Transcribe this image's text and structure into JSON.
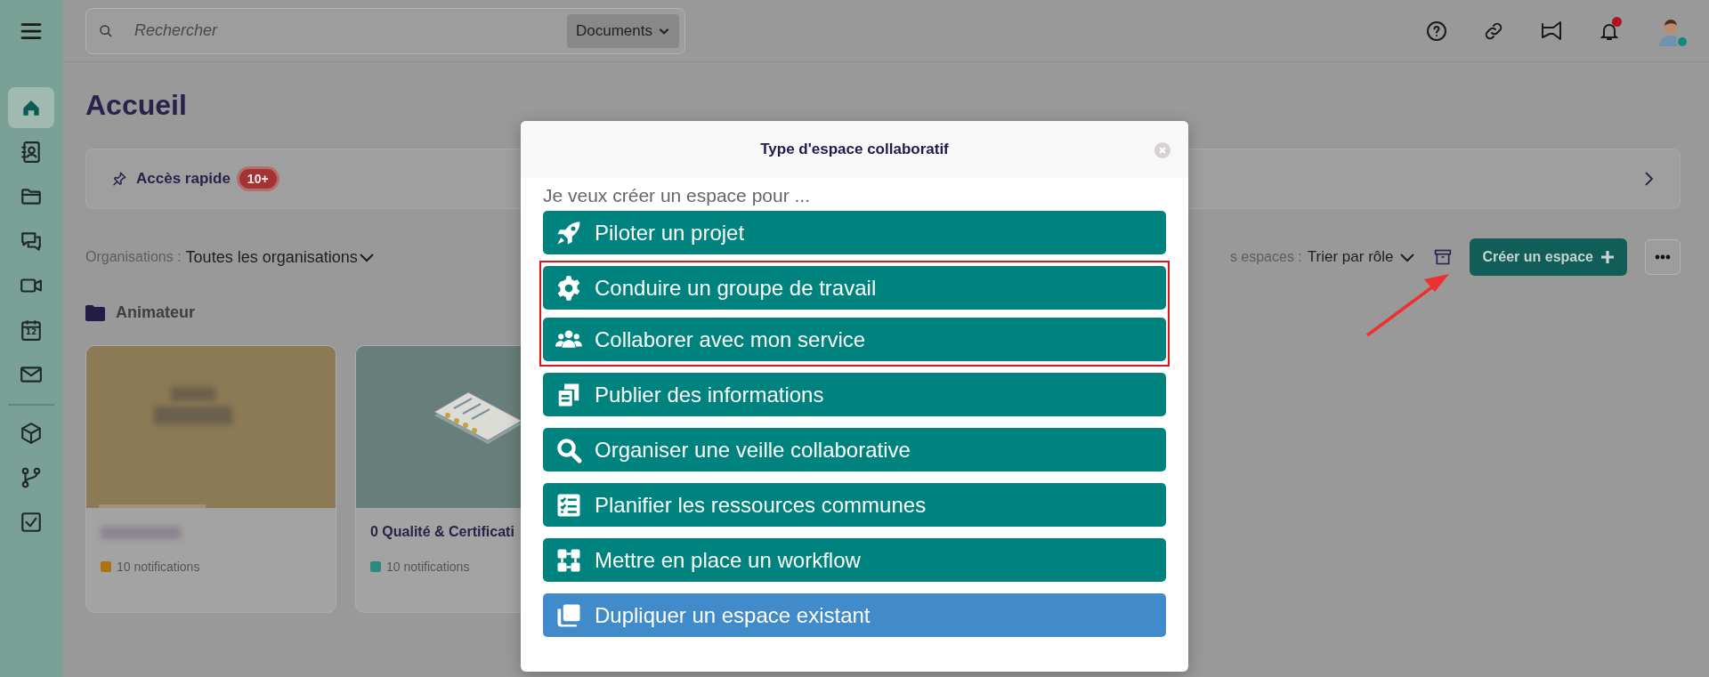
{
  "search": {
    "placeholder": "Rechercher",
    "scope": "Documents"
  },
  "sidebar": {
    "items": [
      {
        "selected": true
      },
      {
        "selected": false
      },
      {
        "selected": false
      },
      {
        "selected": false
      },
      {
        "selected": false
      },
      {
        "selected": false,
        "day": "12"
      },
      {
        "selected": false
      },
      {
        "selected": false
      },
      {
        "selected": false
      },
      {
        "selected": false
      }
    ]
  },
  "header": {
    "notifications_unread": true,
    "user_online": true
  },
  "page": {
    "title": "Accueil"
  },
  "quick_access": {
    "label": "Accès rapide",
    "badge": "10+"
  },
  "filters": {
    "org_label": "Organisations :",
    "org_value": "Toutes les organisations",
    "sort_label": "s espaces :",
    "sort_value": "Trier par rôle",
    "create_button": "Créer un espace"
  },
  "section": {
    "title": "Animateur"
  },
  "cards": [
    {
      "notifications": "10 notifications",
      "color": "#a8750f",
      "kind": "blurred"
    },
    {
      "title": "0 Qualité & Certificati",
      "notifications": "10 notifications",
      "color": "#2e8880",
      "kind": "documents"
    }
  ],
  "modal": {
    "title": "Type d'espace collaboratif",
    "prompt": "Je veux créer un espace pour ...",
    "options": [
      {
        "label": "Piloter un projet",
        "color": "#00837e",
        "highlighted": false
      },
      {
        "label": "Conduire un groupe de travail",
        "color": "#00837e",
        "highlighted": true
      },
      {
        "label": "Collaborer avec mon service",
        "color": "#00837e",
        "highlighted": true
      },
      {
        "label": "Publier des informations",
        "color": "#00837e",
        "highlighted": false
      },
      {
        "label": "Organiser une veille collaborative",
        "color": "#00837e",
        "highlighted": false
      },
      {
        "label": "Planifier les ressources communes",
        "color": "#00837e",
        "highlighted": false
      },
      {
        "label": "Mettre en place un workflow",
        "color": "#00837e",
        "highlighted": false
      },
      {
        "label": "Dupliquer un espace existant",
        "color": "#428bca",
        "highlighted": false
      }
    ]
  }
}
